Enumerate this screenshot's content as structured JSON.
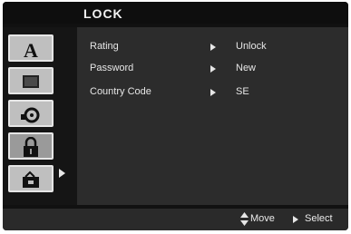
{
  "header": {
    "title": "LOCK"
  },
  "sidebar": {
    "tabs": [
      {
        "icon": "language-icon"
      },
      {
        "icon": "display-icon"
      },
      {
        "icon": "audio-icon"
      },
      {
        "icon": "lock-icon",
        "active": true
      },
      {
        "icon": "other-settings-icon"
      }
    ]
  },
  "menu": {
    "items": [
      {
        "label": "Rating",
        "value": "Unlock"
      },
      {
        "label": "Password",
        "value": "New"
      },
      {
        "label": "Country Code",
        "value": "SE"
      }
    ]
  },
  "footer": {
    "move_label": "Move",
    "select_label": "Select"
  }
}
